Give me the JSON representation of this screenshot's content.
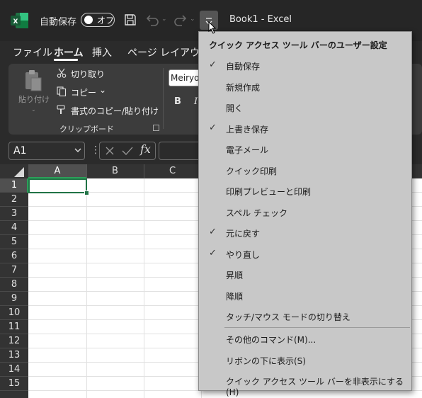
{
  "titlebar": {
    "autosave_label": "自動保存",
    "autosave_state": "オフ",
    "document_title": "Book1  -  Excel",
    "chevron": "⌄"
  },
  "tabs": [
    "ファイル",
    "ホーム",
    "挿入",
    "ページ レイアウト"
  ],
  "ribbon": {
    "paste_label": "貼り付け",
    "cut_label": "切り取り",
    "copy_label": "コピー",
    "copy_chevron": "⌄",
    "format_painter_label": "書式のコピー/貼り付け",
    "clipboard_group": "クリップボード",
    "font_name": "Meiryo",
    "bold": "B",
    "italic": "I"
  },
  "formula_bar": {
    "name_box": "A1",
    "dots": "⋮",
    "fx": "fx"
  },
  "grid": {
    "columns": [
      "A",
      "B",
      "C"
    ],
    "rows": [
      "1",
      "2",
      "3",
      "4",
      "5",
      "6",
      "7",
      "8",
      "9",
      "10",
      "11",
      "12",
      "13",
      "14",
      "15"
    ],
    "selected_cell": "A1"
  },
  "qat_menu": {
    "header": "クイック アクセス ツール バーのユーザー設定",
    "check_glyph": "✓",
    "items": [
      {
        "label": "自動保存",
        "checked": true
      },
      {
        "label": "新規作成",
        "checked": false
      },
      {
        "label": "開く",
        "checked": false
      },
      {
        "label": "上書き保存",
        "checked": true
      },
      {
        "label": "電子メール",
        "checked": false
      },
      {
        "label": "クイック印刷",
        "checked": false
      },
      {
        "label": "印刷プレビューと印刷",
        "checked": false
      },
      {
        "label": "スペル チェック",
        "checked": false
      },
      {
        "label": "元に戻す",
        "checked": true
      },
      {
        "label": "やり直し",
        "checked": true
      },
      {
        "label": "昇順",
        "checked": false
      },
      {
        "label": "降順",
        "checked": false
      },
      {
        "label": "タッチ/マウス モードの切り替え",
        "checked": false
      }
    ],
    "more_commands": "その他のコマンド(M)...",
    "show_below_ribbon": "リボンの下に表示(S)",
    "hide_qat": "クイック アクセス ツール バーを非表示にする (H)"
  },
  "colors": {
    "accent_green": "#217346",
    "menu_bg": "#c8c8c8",
    "ribbon_bg": "#3c3c3c"
  }
}
